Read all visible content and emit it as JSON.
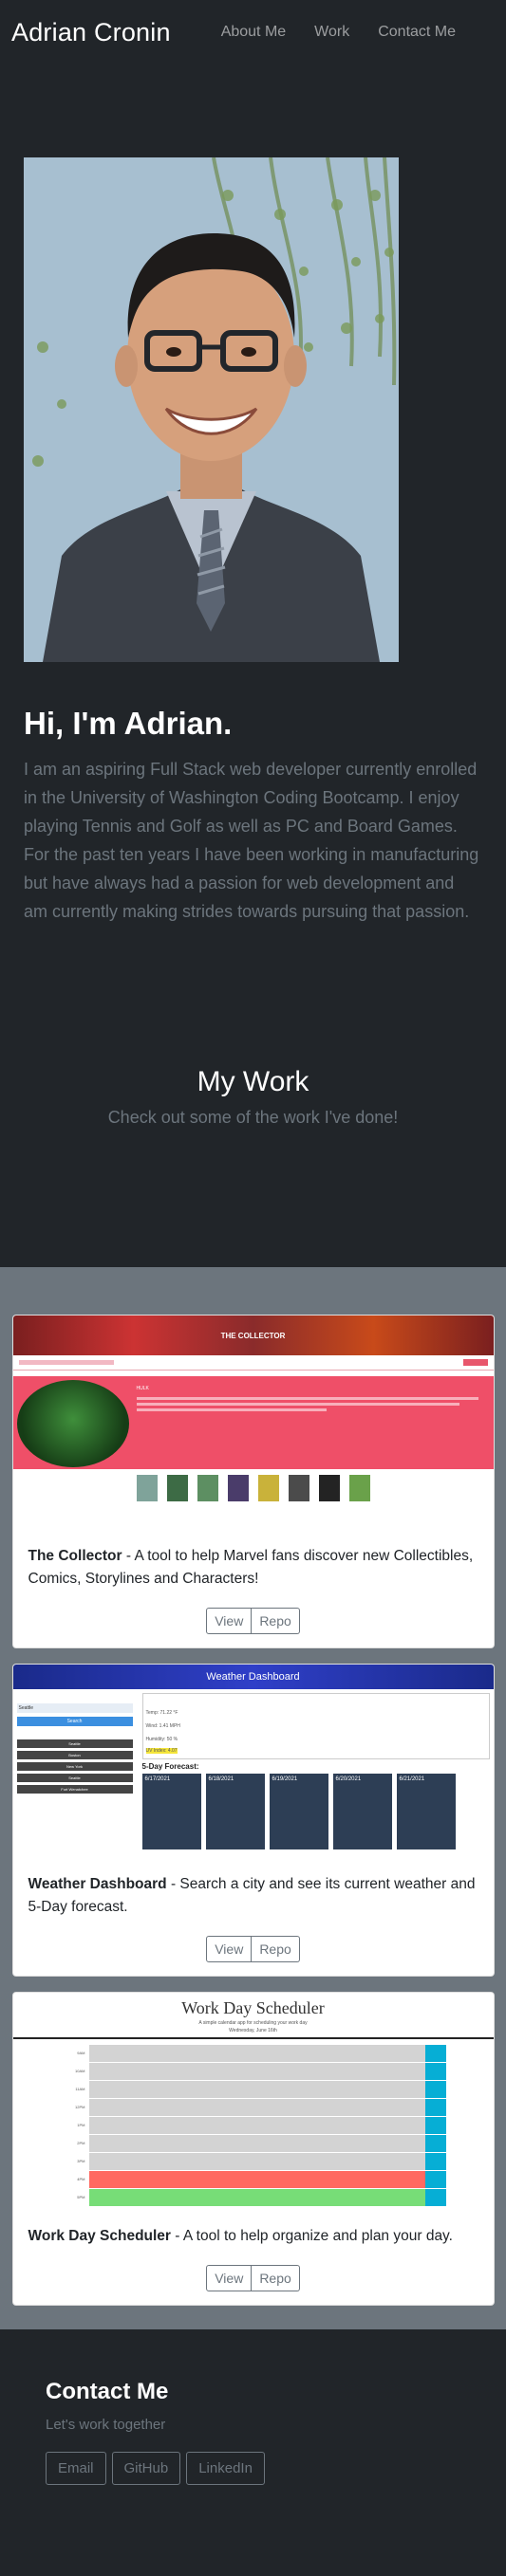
{
  "nav": {
    "brand": "Adrian Cronin",
    "links": [
      "About Me",
      "Work",
      "Contact Me"
    ]
  },
  "hero": {
    "greeting": "Hi, I'm Adrian.",
    "bio_1": "I am an aspiring Full Stack web developer currently enrolled in the University of Washington Coding Bootcamp. I enjoy playing Tennis and Golf as well as PC and Board Games.",
    "bio_2": "For the past ten years I have been working in manufacturing but have always had a passion for web development and am currently making strides towards pursuing that passion."
  },
  "work_header": {
    "title": "My Work",
    "subtitle": "Check out some of the work I've done!"
  },
  "projects": [
    {
      "name": "The Collector",
      "desc": " - A tool to help Marvel fans discover new Collectibles, Comics, Storylines and Characters!",
      "view": "View",
      "repo": "Repo",
      "shot_title": "THE COLLECTOR",
      "shot_heading": "HULK"
    },
    {
      "name": "Weather Dashboard",
      "desc": " - Search a city and see its current weather and 5-Day forecast.",
      "view": "View",
      "repo": "Repo",
      "shot_title": "Weather Dashboard",
      "shot_search_label": "Search for a City:",
      "shot_input": "Seattle",
      "shot_search_btn": "Search",
      "shot_cities": [
        "Seattle",
        "Boston",
        "New York",
        "Seattle",
        "Fort Wenatchee"
      ],
      "shot_city_heading": "Seattle (6/16/2021)",
      "shot_temp": "Temp: 71.22 °F",
      "shot_wind": "Wind: 1.41 MPH",
      "shot_humidity": "Humidity: 50 %",
      "shot_uv": "UV Index: 4.07",
      "shot_forecast_label": "5-Day Forecast:",
      "shot_days": [
        "6/17/2021",
        "6/18/2021",
        "6/19/2021",
        "6/20/2021",
        "6/21/2021"
      ]
    },
    {
      "name": "Work Day Scheduler",
      "desc": " - A tool to help organize and plan your day.",
      "view": "View",
      "repo": "Repo",
      "shot_title": "Work Day Scheduler",
      "shot_sub": "A simple calendar app for scheduling your work day",
      "shot_date": "Wednesday, June 16th",
      "shot_hours": [
        "9AM",
        "10AM",
        "11AM",
        "12PM",
        "1PM",
        "2PM",
        "3PM",
        "4PM",
        "5PM"
      ]
    }
  ],
  "contact": {
    "title": "Contact Me",
    "subtitle": "Let's work together",
    "buttons": [
      "Email",
      "GitHub",
      "LinkedIn"
    ]
  },
  "colors": {
    "bg_dark": "#212529",
    "bg_gray": "#6c757d",
    "muted": "#6c757d"
  }
}
